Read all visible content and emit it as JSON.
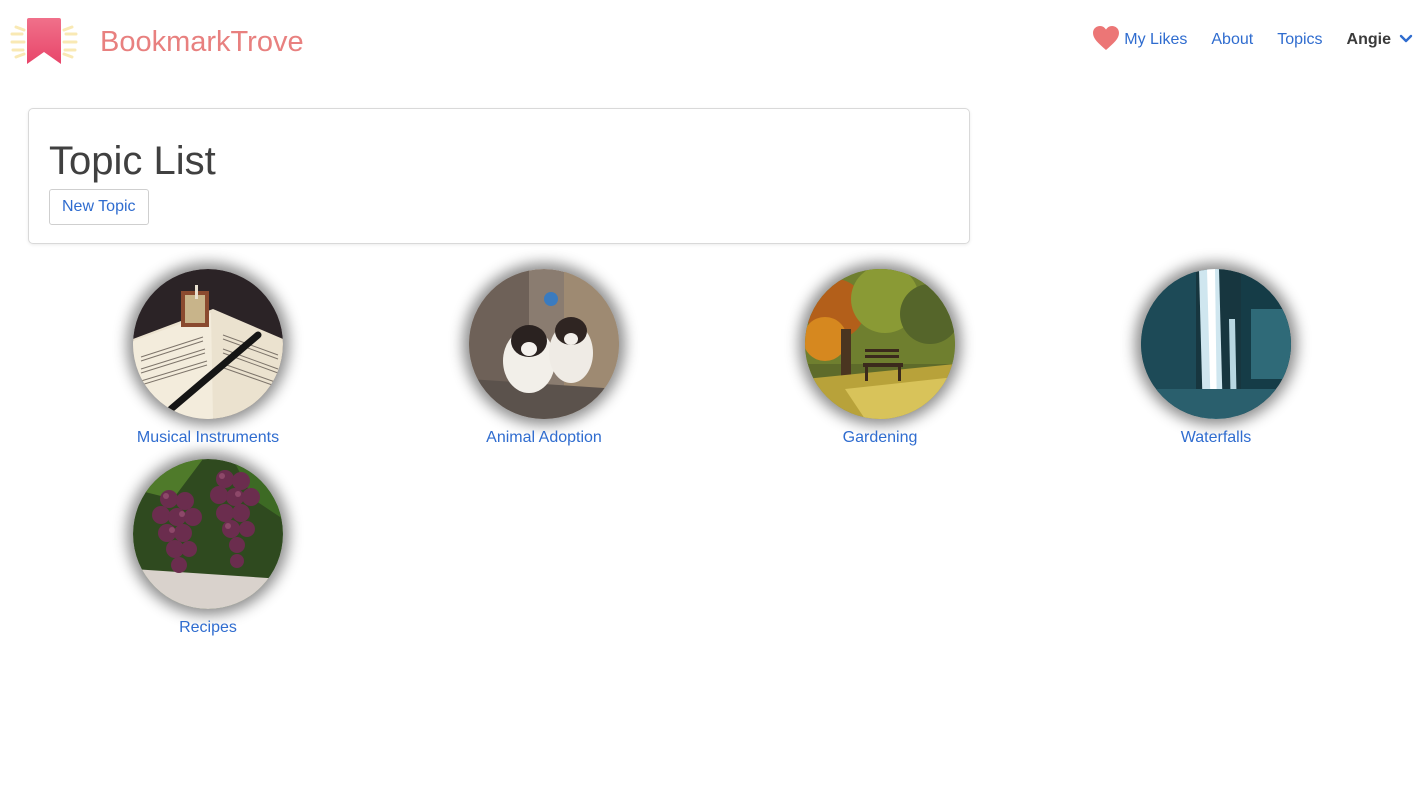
{
  "brand": {
    "name": "BookmarkTrove",
    "logo_icon": "bookmark-icon",
    "color": "#e8807f"
  },
  "nav": {
    "likes_label": "My Likes",
    "likes_icon": "heart-icon",
    "about_label": "About",
    "topics_label": "Topics",
    "user_name": "Angie",
    "user_menu_icon": "chevron-down-icon",
    "link_color": "#2f6ccf"
  },
  "main": {
    "title": "Topic List",
    "new_topic_label": "New Topic"
  },
  "topics": [
    {
      "label": "Musical Instruments",
      "image": "sheet-music-recorder-photo"
    },
    {
      "label": "Animal Adoption",
      "image": "puppies-photo"
    },
    {
      "label": "Gardening",
      "image": "garden-bench-photo"
    },
    {
      "label": "Waterfalls",
      "image": "waterfall-photo"
    },
    {
      "label": "Recipes",
      "image": "grapes-photo"
    }
  ]
}
